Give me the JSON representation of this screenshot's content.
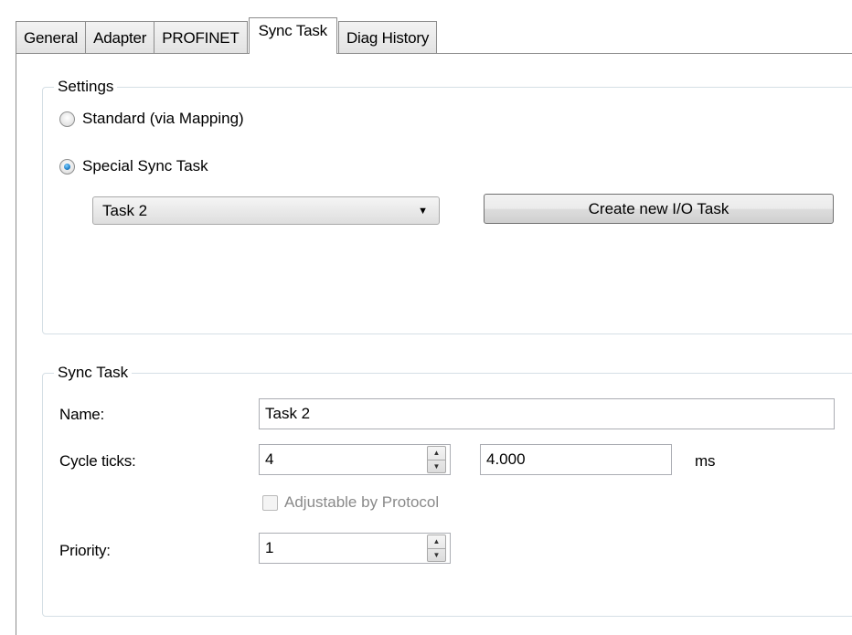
{
  "tabs": [
    {
      "label": "General",
      "active": false
    },
    {
      "label": "Adapter",
      "active": false
    },
    {
      "label": "PROFINET",
      "active": false
    },
    {
      "label": "Sync Task",
      "active": true
    },
    {
      "label": "Diag History",
      "active": false
    }
  ],
  "settings": {
    "title": "Settings",
    "radio_standard": "Standard (via Mapping)",
    "radio_special": "Special Sync Task",
    "selected": "special",
    "task_select_value": "Task 2",
    "create_button": "Create new I/O Task"
  },
  "sync_task": {
    "title": "Sync Task",
    "name_label": "Name:",
    "name_value": "Task 2",
    "cycle_label": "Cycle ticks:",
    "cycle_value": "4",
    "cycle_ms_value": "4.000",
    "ms_unit": "ms",
    "adjustable_label": "Adjustable by Protocol",
    "adjustable_checked": false,
    "adjustable_enabled": false,
    "priority_label": "Priority:",
    "priority_value": "1"
  },
  "icons": {
    "spin_up": "spin-up-arrow-icon",
    "spin_down": "spin-down-arrow-icon",
    "dropdown": "chevron-down-icon"
  },
  "colors": {
    "tab_border": "#8d8d8d",
    "group_border": "#d5dfe5",
    "radio_checked": "#1f7fc8",
    "disabled_text": "#8a8a8a"
  }
}
